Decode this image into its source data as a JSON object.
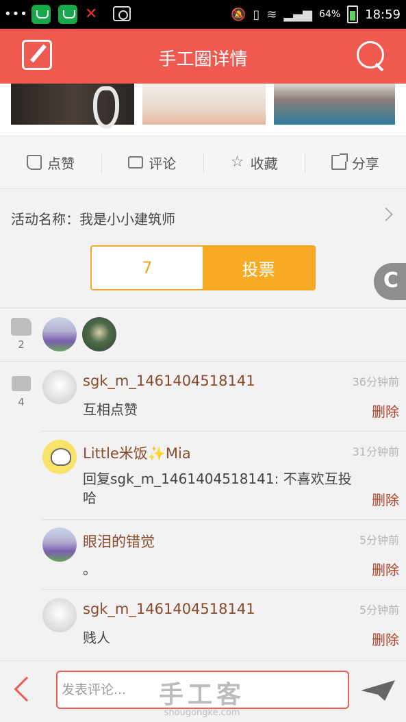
{
  "status_bar": {
    "battery": "64%",
    "time": "18:59"
  },
  "header": {
    "title": "手工圈详情"
  },
  "actions": [
    {
      "label": "点赞"
    },
    {
      "label": "评论"
    },
    {
      "label": "收藏"
    },
    {
      "label": "分享"
    }
  ],
  "activity": {
    "label": "活动名称：我是小小建筑师",
    "vote_count": "7",
    "vote_button": "投票"
  },
  "likes": {
    "count": "2"
  },
  "comments": {
    "count": "4",
    "items": [
      {
        "name": "sgk_m_1461404518141",
        "time": "36分钟前",
        "text": "互相点赞",
        "delete": "删除"
      },
      {
        "name": "Little米饭✨Mia",
        "time": "31分钟前",
        "text": "回复sgk_m_1461404518141: 不喜欢互投哈",
        "delete": "删除"
      },
      {
        "name": "眼泪的错觉",
        "time": "5分钟前",
        "text": "。",
        "delete": "删除"
      },
      {
        "name": "sgk_m_1461404518141",
        "time": "5分钟前",
        "text": "贱人",
        "delete": "删除"
      }
    ]
  },
  "bottom": {
    "placeholder": "发表评论..."
  },
  "watermark": {
    "title": "手工客",
    "url": "shougongke.com"
  }
}
